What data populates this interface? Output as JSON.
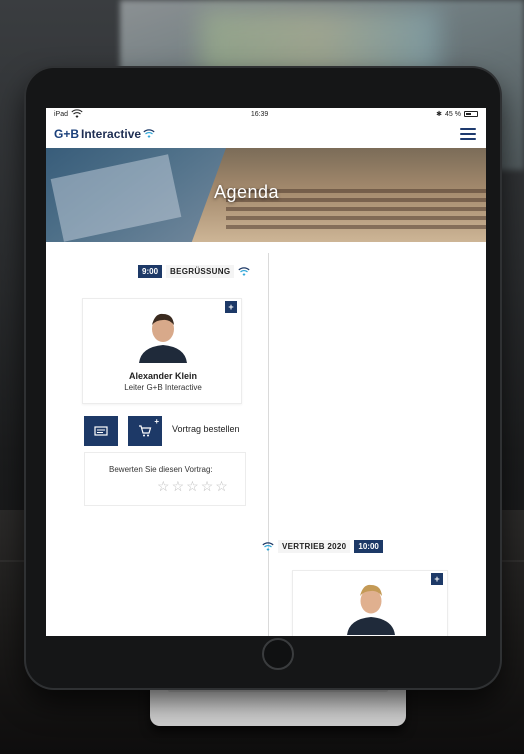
{
  "status_bar": {
    "time": "16:39",
    "carrier": "iPad",
    "battery": "45 %"
  },
  "header": {
    "logo_gb": "G+B",
    "logo_text": "Interactive"
  },
  "banner": {
    "title": "Agenda"
  },
  "sessions": [
    {
      "time": "9:00",
      "title": "BEGRÜSSUNG",
      "speaker_name": "Alexander Klein",
      "speaker_role": "Leiter G+B Interactive",
      "order_label": "Vortrag bestellen",
      "rating_label": "Bewerten Sie diesen Vortrag:",
      "rating": 0,
      "rating_max": 5
    },
    {
      "time": "10:00",
      "title": "VERTRIEB 2020"
    }
  ],
  "colors": {
    "brand_navy": "#1d3967",
    "brand_cyan": "#2fa6d8"
  },
  "icons": {
    "plus": "+",
    "cart": "🛒",
    "presentation": "▭"
  }
}
